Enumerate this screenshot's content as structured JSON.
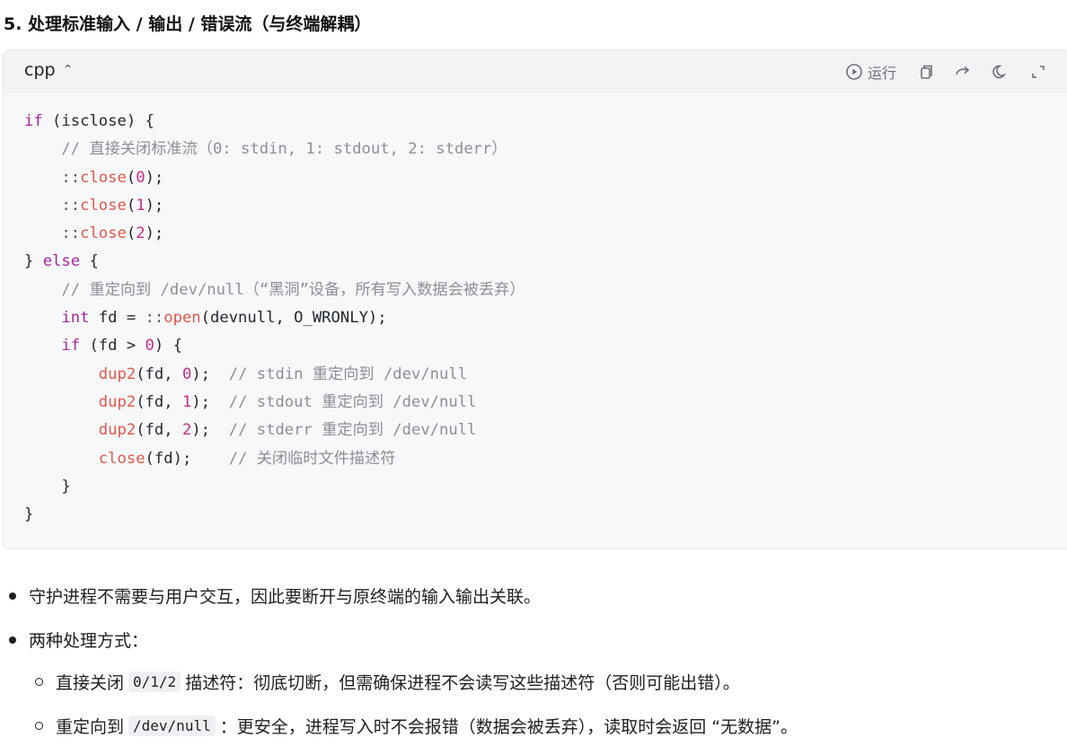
{
  "heading": "5. 处理标准输入 / 输出 / 错误流（与终端解耦）",
  "code_block": {
    "language": "cpp",
    "run_label": "运行"
  },
  "bullets": {
    "item1": "守护进程不需要与用户交互，因此要断开与原终端的输入输出关联。",
    "item2": "两种处理方式：",
    "sub1_pre": "直接关闭",
    "sub1_code": "0/1/2",
    "sub1_post": "描述符：彻底切断，但需确保进程不会读写这些描述符（否则可能出错）。",
    "sub2_pre": "重定向到",
    "sub2_code": "/dev/null",
    "sub2_post": "：更安全，进程写入时不会报错（数据会被丢弃），读取时会返回 “无数据”。"
  }
}
